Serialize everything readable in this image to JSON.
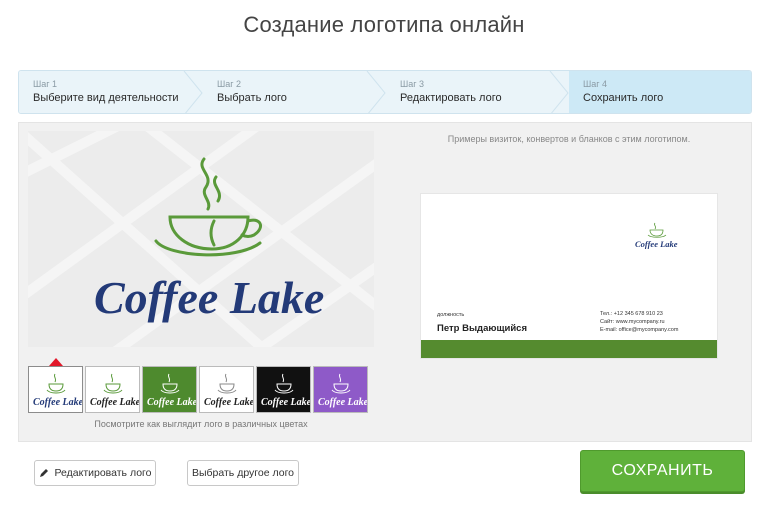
{
  "page": {
    "title": "Создание логотипа онлайн"
  },
  "steps": [
    {
      "num": "Шаг 1",
      "label": "Выберите вид деятельности"
    },
    {
      "num": "Шаг 2",
      "label": "Выбрать лого"
    },
    {
      "num": "Шаг 3",
      "label": "Редактировать лого"
    },
    {
      "num": "Шаг 4",
      "label": "Сохранить лого"
    }
  ],
  "logo": {
    "brand_name": "Coffee Lake",
    "brand_color": "#233a78",
    "accent_color": "#5a9a3a"
  },
  "swatches": {
    "caption": "Посмотрите как выглядит лого в различных цветах",
    "items": [
      {
        "bg": "#ffffff",
        "text": "#233a78",
        "cup": "#5a9a3a",
        "label": "Coffee Lake"
      },
      {
        "bg": "#ffffff",
        "text": "#222222",
        "cup": "#5a9a3a",
        "label": "Coffee Lake"
      },
      {
        "bg": "#4e8a2e",
        "text": "#ffffff",
        "cup": "#ffffff",
        "label": "Coffee Lake"
      },
      {
        "bg": "#ffffff",
        "text": "#222222",
        "cup": "#888888",
        "label": "Coffee Lake"
      },
      {
        "bg": "#111111",
        "text": "#ffffff",
        "cup": "#ffffff",
        "label": "Coffee Lake"
      },
      {
        "bg": "#8e5ac8",
        "text": "#ffffff",
        "cup": "#ffffff",
        "label": "Coffee Lake"
      }
    ]
  },
  "preview": {
    "caption": "Примеры визиток, конвертов и бланков с этим логотипом.",
    "card": {
      "position": "должность",
      "name": "Петр Выдающийся",
      "phone": "Тел.: +12 345 678 910 23",
      "site": "Сайт: www.mycompany.ru",
      "email": "E-mail: office@mycompany.com",
      "stripe_color": "#558b2f"
    }
  },
  "actions": {
    "edit_label": "Редактировать лого",
    "other_label": "Выбрать другое лого",
    "save_label": "СОХРАНИТЬ"
  }
}
